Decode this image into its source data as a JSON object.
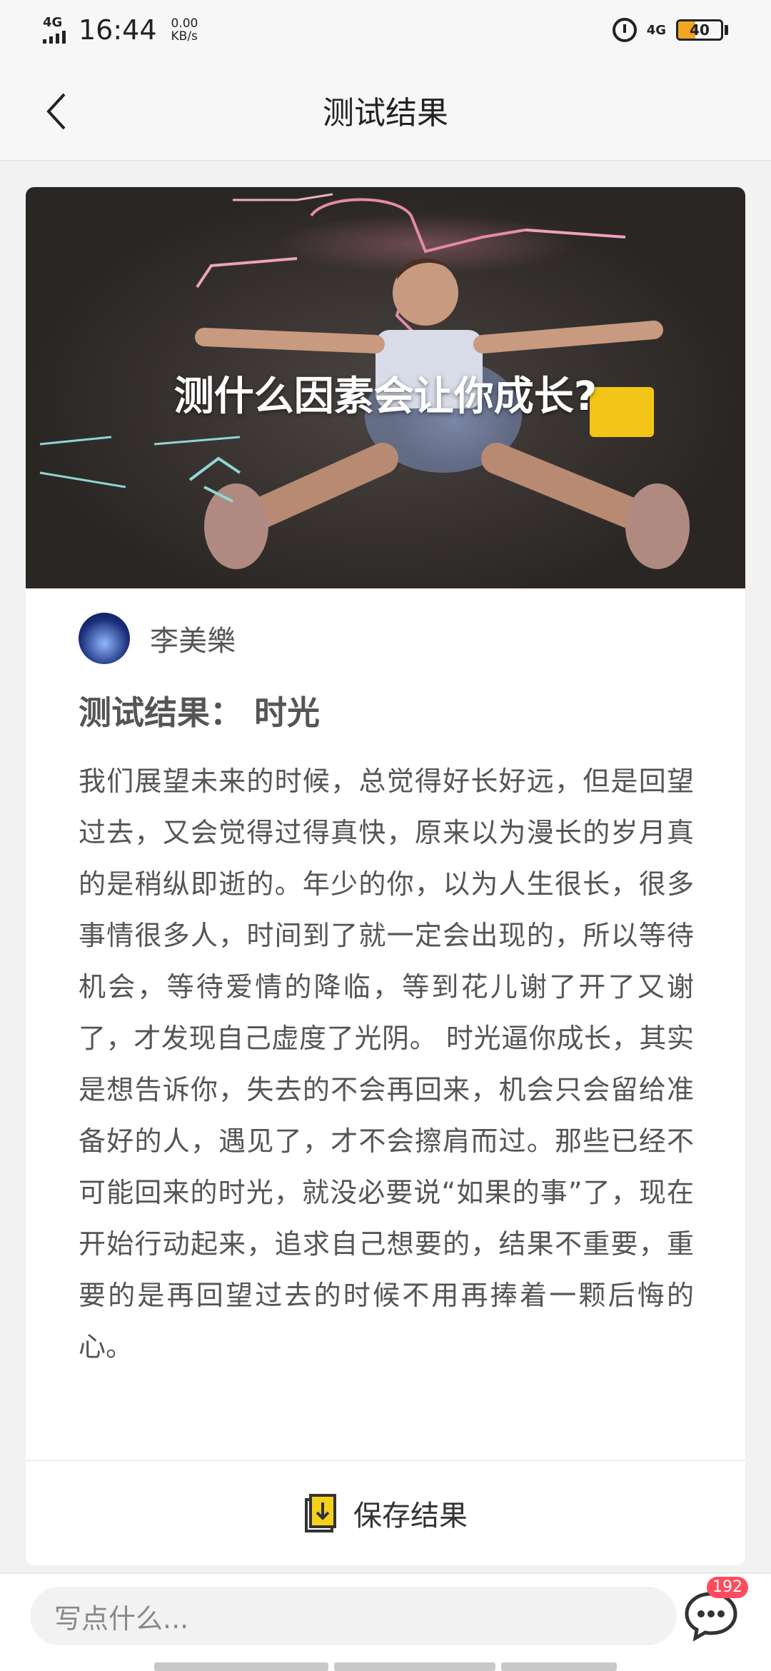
{
  "status_bar": {
    "network": "4G",
    "time": "16:44",
    "speed_value": "0.00",
    "speed_unit": "KB/s",
    "network_right": "4G",
    "battery": "40",
    "battery_level": 0.4,
    "battery_color": "#f3a623"
  },
  "nav": {
    "title": "测试结果",
    "back_icon": "chevron-left-icon"
  },
  "hero": {
    "title": "测什么因素会让你成长?"
  },
  "author": {
    "name": "李美樂"
  },
  "result": {
    "title": "测试结果：  时光",
    "body": "我们展望未来的时候，总觉得好长好远，但是回望过去，又会觉得过得真快，原来以为漫长的岁月真的是稍纵即逝的。年少的你，以为人生很长，很多事情很多人，时间到了就一定会出现的，所以等待机会，等待爱情的降临，等到花儿谢了开了又谢了，才发现自己虚度了光阴。 时光逼你成长，其实是想告诉你，失去的不会再回来，机会只会留给准备好的人，遇见了，才不会擦肩而过。那些已经不可能回来的时光，就没必要说“如果的事”了，现在开始行动起来，追求自己想要的，结果不重要，重要的是再回望过去的时候不用再捧着一颗后悔的心。"
  },
  "actions": {
    "save_label": "保存结果",
    "save_icon": "download-file-icon",
    "accent": "#f5d11a"
  },
  "bottom_bar": {
    "comment_placeholder": "写点什么...",
    "comment_count": "192",
    "comment_icon": "chat-bubble-icon",
    "badge_color": "#ff4b5c"
  }
}
